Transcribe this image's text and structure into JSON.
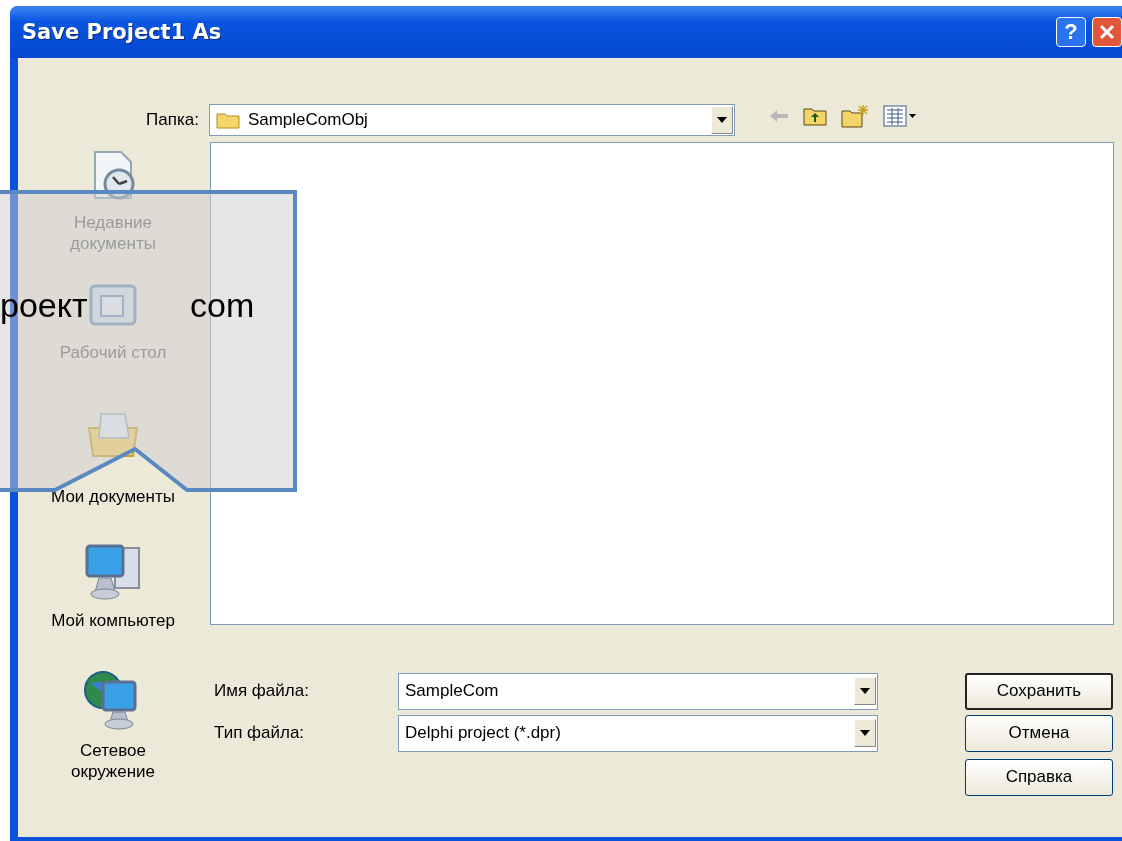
{
  "window": {
    "title": "Save Project1 As",
    "help_label": "?"
  },
  "location": {
    "label": "Папка:",
    "value": "SampleComObj"
  },
  "places": [
    {
      "kind": "recent",
      "label": "Недавние документы"
    },
    {
      "kind": "desktop",
      "label": "Рабочий стол"
    },
    {
      "kind": "documents",
      "label": "Мои документы"
    },
    {
      "kind": "computer",
      "label": "Мой компьютер"
    },
    {
      "kind": "network",
      "label": "Сетевое окружение"
    }
  ],
  "file_name": {
    "label": "Имя файла:",
    "value": "SampleCom"
  },
  "file_type": {
    "label": "Тип файла:",
    "value": "Delphi project (*.dpr)"
  },
  "buttons": [
    {
      "label": "Сохранить",
      "default": true
    },
    {
      "label": "Отмена",
      "default": false
    },
    {
      "label": "Справка",
      "default": false
    }
  ],
  "callout": {
    "texts": [
      "роект",
      "com"
    ]
  }
}
